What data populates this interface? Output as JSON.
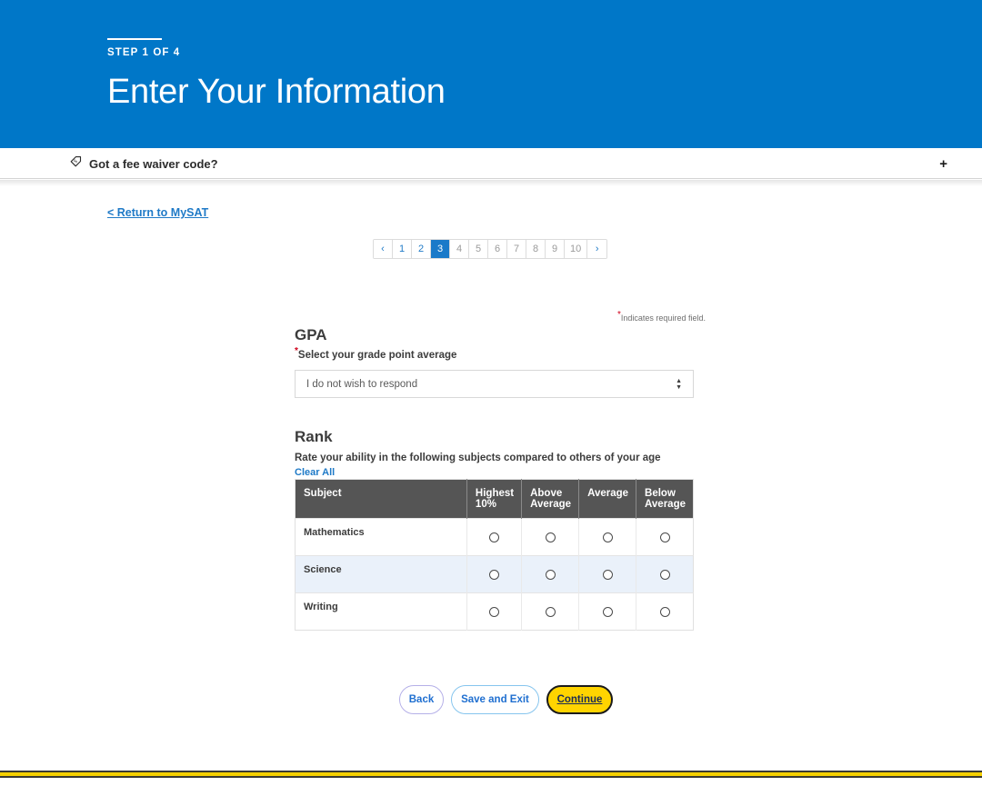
{
  "hero": {
    "step_label": "STEP 1 OF 4",
    "title": "Enter Your Information",
    "bg_color": "#0077c8"
  },
  "fee_bar": {
    "icon": "price-tag-dollar-icon",
    "label": "Got a fee waiver code?",
    "expand_label": "+"
  },
  "return_link": {
    "label": "< Return to MySAT"
  },
  "pagination": {
    "prev_label": "‹",
    "next_label": "›",
    "pages": [
      "1",
      "2",
      "3",
      "4",
      "5",
      "6",
      "7",
      "8",
      "9",
      "10"
    ],
    "active_page": "3",
    "visited_pages": [
      "1",
      "2"
    ],
    "active_color": "#1a7ac9",
    "link_color": "#1f7ac7"
  },
  "required_note": {
    "star": "*",
    "text": "Indicates required field.",
    "star_color": "#d0021b"
  },
  "gpa": {
    "heading": "GPA",
    "star": "*",
    "sublabel": "Select your grade point average",
    "select_value": "I do not wish to respond",
    "select_icon": "updown-spinner-icon"
  },
  "rank": {
    "heading": "Rank",
    "sublabel": "Rate your ability in the following subjects compared to others of your age",
    "clear_all_label": "Clear All",
    "columns": [
      "Subject",
      "Highest 10%",
      "Above Average",
      "Average",
      "Below Average"
    ],
    "rows": [
      {
        "subject": "Mathematics",
        "selected": null
      },
      {
        "subject": "Science",
        "selected": null
      },
      {
        "subject": "Writing",
        "selected": null
      }
    ],
    "header_bg": "#555555",
    "alt_row_bg": "#eaf1fa"
  },
  "buttons": {
    "back": "Back",
    "save_and_exit": "Save and Exit",
    "continue": "Continue",
    "continue_bg": "#ffd400"
  },
  "bottom_bar": {
    "color": "#f5d000"
  }
}
